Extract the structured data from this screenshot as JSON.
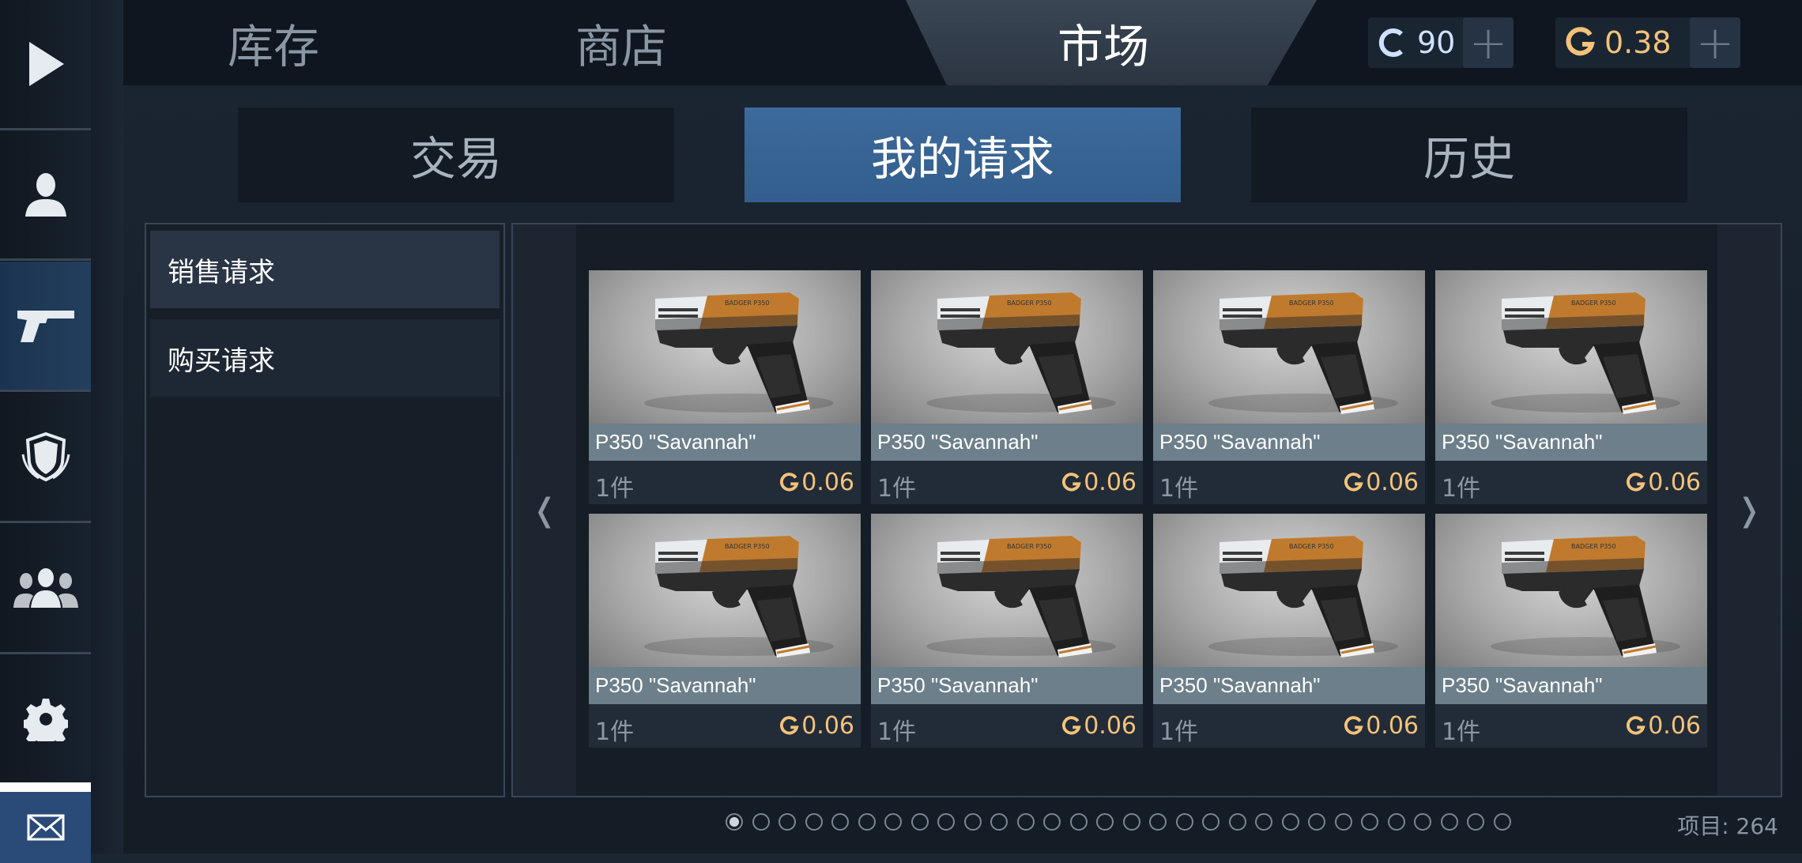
{
  "nav": {
    "items": [
      {
        "name": "play-icon",
        "active": false
      },
      {
        "name": "profile-icon",
        "active": false
      },
      {
        "name": "pistol-icon",
        "active": true
      },
      {
        "name": "shield-emblem-icon",
        "active": false
      },
      {
        "name": "friends-icon",
        "active": false
      },
      {
        "name": "gear-icon",
        "active": false
      }
    ],
    "mail_icon": "mail-icon"
  },
  "top_tabs": {
    "inventory": "库存",
    "shop": "商店",
    "market": "市场",
    "active": "market"
  },
  "currency": {
    "silver": {
      "value": "90",
      "icon": "silver-coin-icon",
      "color": "#cfe1ff"
    },
    "gold": {
      "value": "0.38",
      "icon": "gold-coin-icon",
      "color": "#f4c27a"
    },
    "plus": "+"
  },
  "sub_tabs": {
    "trade": "交易",
    "my_requests": "我的请求",
    "history": "历史",
    "active": "my_requests"
  },
  "requests": {
    "sell": "销售请求",
    "buy": "购买请求",
    "active": "sell"
  },
  "pager": {
    "prev": "❬",
    "next": "❭",
    "total_pages": 30,
    "current_page": 1
  },
  "cards": [
    {
      "name": "P350 \"Savannah\"",
      "qty": "1件",
      "price": "0.06"
    },
    {
      "name": "P350 \"Savannah\"",
      "qty": "1件",
      "price": "0.06"
    },
    {
      "name": "P350 \"Savannah\"",
      "qty": "1件",
      "price": "0.06"
    },
    {
      "name": "P350 \"Savannah\"",
      "qty": "1件",
      "price": "0.06"
    },
    {
      "name": "P350 \"Savannah\"",
      "qty": "1件",
      "price": "0.06"
    },
    {
      "name": "P350 \"Savannah\"",
      "qty": "1件",
      "price": "0.06"
    },
    {
      "name": "P350 \"Savannah\"",
      "qty": "1件",
      "price": "0.06"
    },
    {
      "name": "P350 \"Savannah\"",
      "qty": "1件",
      "price": "0.06"
    }
  ],
  "colors": {
    "accent": "#335e8c",
    "gold": "#f4c27a"
  },
  "footer": {
    "items_count": "项目: 264"
  }
}
